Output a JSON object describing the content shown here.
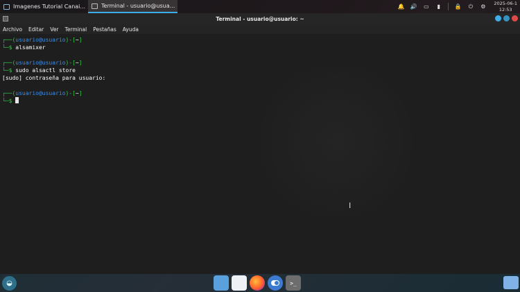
{
  "top_panel": {
    "tasks": [
      {
        "label": "Imagenes Tutorial Canai...",
        "icon": "folder-icon",
        "active": false
      },
      {
        "label": "Terminal - usuario@usua...",
        "icon": "terminal-icon",
        "active": true
      }
    ],
    "clock": {
      "date": "2025-06-1",
      "time": "12:53"
    }
  },
  "window": {
    "title": "Terminal - usuario@usuario: ~"
  },
  "menu": [
    "Archivo",
    "Editar",
    "Ver",
    "Terminal",
    "Pestañas",
    "Ayuda"
  ],
  "terminal": {
    "lines": [
      {
        "open": "┌──(",
        "user": "usuario@usuario",
        "close": ")-[",
        "dir": "~",
        "end": "]"
      },
      {
        "prompt": "└─$ ",
        "cmd": "alsamixer"
      },
      {
        "blank": ""
      },
      {
        "open": "┌──(",
        "user": "usuario@usuario",
        "close": ")-[",
        "dir": "~",
        "end": "]"
      },
      {
        "prompt": "└─$ ",
        "cmd": "sudo alsactl store"
      },
      {
        "output": "[sudo] contraseña para usuario:"
      },
      {
        "blank": ""
      },
      {
        "open": "┌──(",
        "user": "usuario@usuario",
        "close": ")-[",
        "dir": "~",
        "end": "]"
      },
      {
        "prompt": "└─$ ",
        "cmd": ""
      }
    ]
  },
  "dock": {
    "items": [
      "file-manager-icon",
      "document-icon",
      "firefox-icon",
      "toggle-icon",
      "terminal-icon"
    ]
  },
  "colors": {
    "prompt_green": "#2ecc40",
    "prompt_blue": "#3b8eea",
    "accent": "#3daee9",
    "close": "#e04a4a"
  }
}
